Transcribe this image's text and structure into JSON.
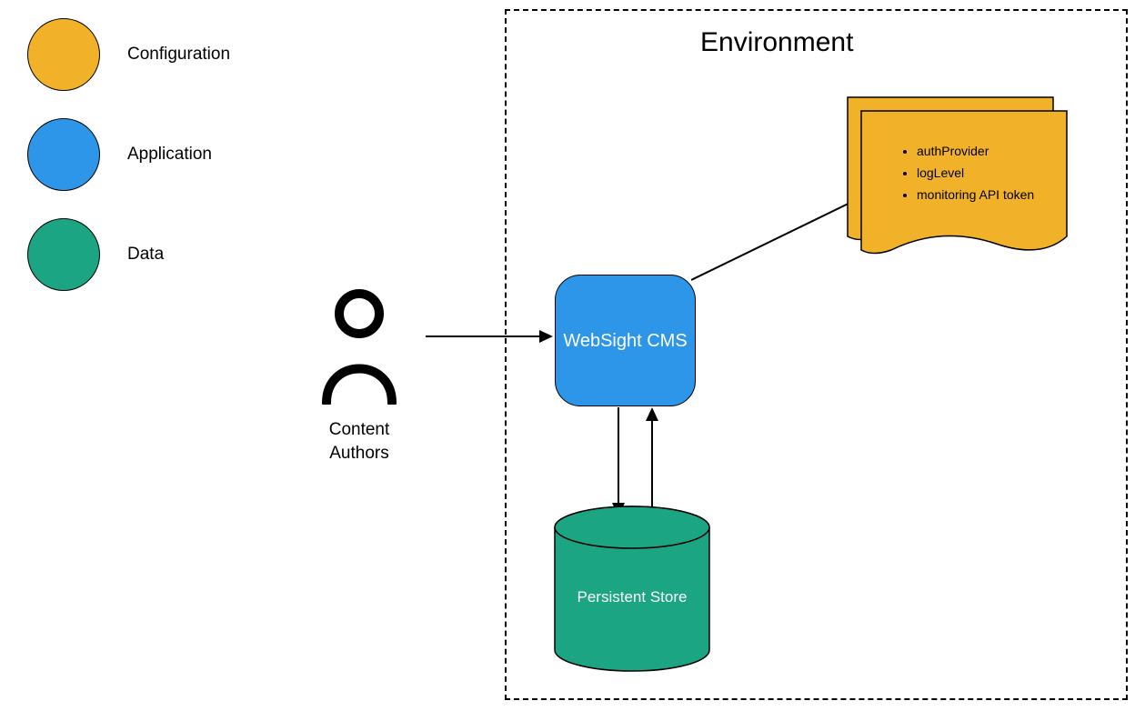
{
  "legend": {
    "items": [
      {
        "label": "Configuration",
        "colorClass": "circle-yellow"
      },
      {
        "label": "Application",
        "colorClass": "circle-blue"
      },
      {
        "label": "Data",
        "colorClass": "circle-green"
      }
    ]
  },
  "environment": {
    "title": "Environment"
  },
  "actor": {
    "label": "Content Authors"
  },
  "app_node": {
    "label": "WebSight CMS"
  },
  "data_node": {
    "label": "Persistent Store"
  },
  "config_note": {
    "items": [
      "authProvider",
      "logLevel",
      "monitoring API token"
    ]
  },
  "colors": {
    "configuration": "#F1B229",
    "application": "#2E96E9",
    "data": "#1BA582"
  }
}
